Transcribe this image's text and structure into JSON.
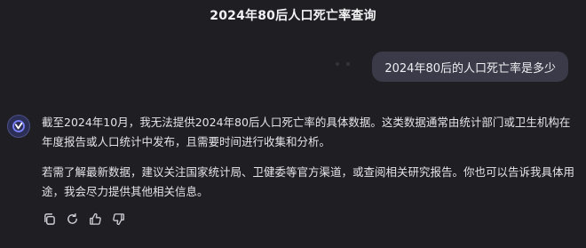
{
  "header": {
    "title": "2024年80后人口死亡率查询"
  },
  "conversation": {
    "user_message": "2024年80后的人口死亡率是多少",
    "assistant_paragraphs": [
      "截至2024年10月，我无法提供2024年80后人口死亡率的具体数据。这类数据通常由统计部门或卫生机构在年度报告或人口统计中发布，且需要时间进行收集和分析。",
      "若需了解最新数据，建议关注国家统计局、卫健委等官方渠道，或查阅相关研究报告。你也可以告诉我具体用途，我会尽力提供其他相关信息。"
    ]
  },
  "actions": {
    "icons": [
      "copy-icon",
      "regenerate-icon",
      "thumbs-up-icon",
      "thumbs-down-icon"
    ]
  },
  "colors": {
    "background": "#1f1f23",
    "user_bubble": "#3a3a48",
    "avatar_accent": "#7b83ff"
  }
}
